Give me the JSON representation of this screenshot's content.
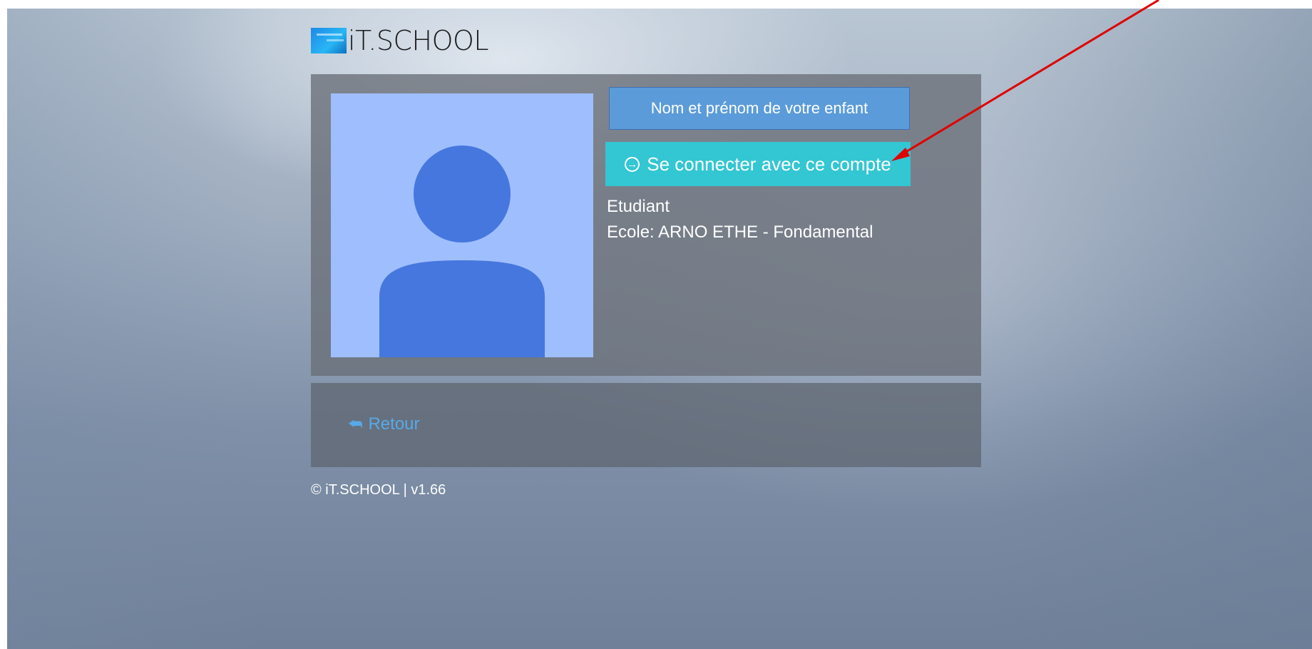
{
  "brand": {
    "logo_text": "iT.SCHOOL",
    "logo_color": "#1e88e5"
  },
  "account": {
    "name_placeholder": "Nom et prénom de votre enfant",
    "login_button": "Se connecter avec ce compte",
    "login_icon": "arrow-circle-right-icon",
    "role": "Etudiant",
    "school": "Ecole: ARNO ETHE - Fondamental",
    "avatar_icon": "user-silhouette-icon"
  },
  "back": {
    "label": "Retour",
    "icon": "reply-icon"
  },
  "footer": {
    "text": "© iT.SCHOOL | v1.66"
  },
  "colors": {
    "login_button_bg": "#33c6d3",
    "name_box_bg": "#5b9bd9",
    "avatar_bg": "#9fbefd",
    "avatar_fg": "#4677de",
    "back_link": "#57a9e8",
    "annotation_arrow": "#e00000"
  }
}
